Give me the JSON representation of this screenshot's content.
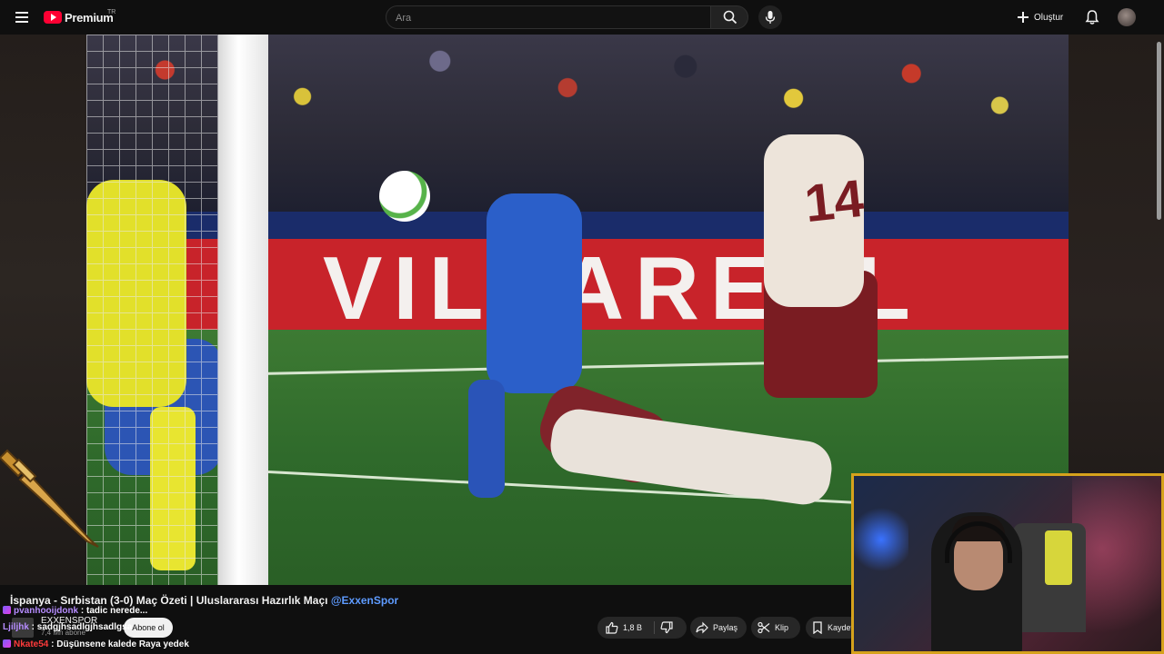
{
  "header": {
    "logo_text": "Premium",
    "country": "TR",
    "search_placeholder": "Ara",
    "create_label": "Oluştur"
  },
  "video": {
    "ad_text": "VILLAREAL",
    "shirt_number": "14"
  },
  "info": {
    "title": "İspanya - Sırbistan (3-0) Maç Özeti | Uluslararası Hazırlık Maçı",
    "title_channel_link": "@ExxenSpor",
    "channel_name": "EXXENSPOR",
    "channel_subs": "7,4 Mn abone",
    "subscribe_label": "Abone ol",
    "like_count": "1,8 B",
    "share_label": "Paylaş",
    "clip_label": "Klip",
    "save_label": "Kaydet"
  },
  "chat": [
    {
      "user": "pvanhooijdonk",
      "user_color": "#b68cff",
      "message": " : tadic nerede..."
    },
    {
      "user": "Ljiljhk",
      "user_color": "#b68cff",
      "message": " : sadgjhsadlgjhsadlgsa"
    },
    {
      "user": "Nkate54",
      "user_color": "#ff3b3b",
      "message": " : Düşünsene kalede Raya yedek"
    }
  ],
  "colors": {
    "accent_red": "#ff0033",
    "link_blue": "#5e9bff",
    "webcam_border": "#d6a21c"
  }
}
